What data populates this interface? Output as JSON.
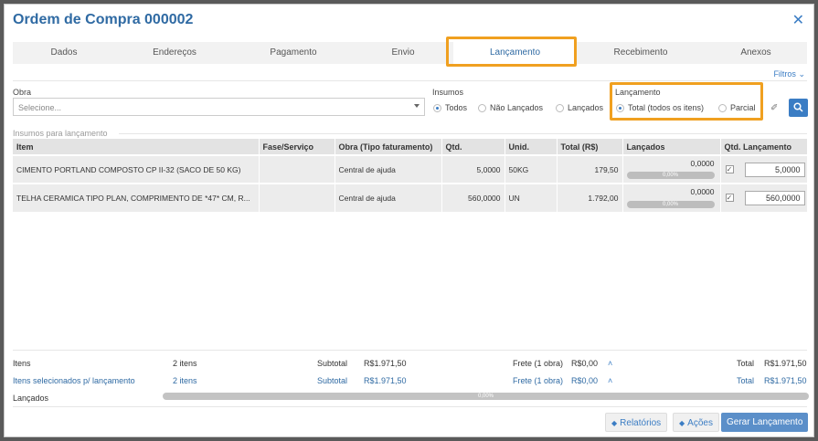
{
  "modal": {
    "title": "Ordem de Compra 000002"
  },
  "tabs": [
    "Dados",
    "Endereços",
    "Pagamento",
    "Envio",
    "Lançamento",
    "Recebimento",
    "Anexos"
  ],
  "active_tab": "Lançamento",
  "filters": {
    "filtros_label": "Filtros",
    "obra_label": "Obra",
    "obra_placeholder": "Selecione...",
    "insumos_label": "Insumos",
    "insumos_options": [
      "Todos",
      "Não Lançados",
      "Lançados"
    ],
    "insumos_selected": "Todos",
    "lancamento_label": "Lançamento",
    "lancamento_options": [
      "Total (todos os itens)",
      "Parcial"
    ],
    "lancamento_selected": "Total (todos os itens)"
  },
  "table": {
    "group_label": "Insumos para lançamento",
    "headers": [
      "Item",
      "Fase/Serviço",
      "Obra (Tipo faturamento)",
      "Qtd.",
      "Unid.",
      "Total (R$)",
      "Lançados",
      "Qtd. Lançamento"
    ],
    "rows": [
      {
        "item": "CIMENTO PORTLAND COMPOSTO CP II-32 (SACO DE 50 KG)",
        "fase": "",
        "obra": "Central de ajuda",
        "qtd": "5,0000",
        "unid": "50KG",
        "total": "179,50",
        "lancados": "0,0000",
        "progress": "0,00%",
        "qtd_lanc": "5,0000"
      },
      {
        "item": "TELHA CERAMICA TIPO PLAN, COMPRIMENTO DE *47* CM, R...",
        "fase": "",
        "obra": "Central de ajuda",
        "qtd": "560,0000",
        "unid": "UN",
        "total": "1.792,00",
        "lancados": "0,0000",
        "progress": "0,00%",
        "qtd_lanc": "560,0000"
      }
    ]
  },
  "footer": {
    "itens_label": "Itens",
    "itens_count": "2 itens",
    "subtotal_label": "Subtotal",
    "subtotal": "R$1.971,50",
    "frete_label": "Frete (1 obra)",
    "frete": "R$0,00",
    "total_label": "Total",
    "total": "R$1.971,50",
    "sel_label": "Itens selecionados p/ lançamento",
    "sel_count": "2 itens",
    "sel_subtotal_label": "Subtotal",
    "sel_subtotal": "R$1.971,50",
    "sel_frete_label": "Frete (1 obra)",
    "sel_frete": "R$0,00",
    "sel_total_label": "Total",
    "sel_total": "R$1.971,50",
    "lancados_label": "Lançados",
    "lancados_progress": "0,00%"
  },
  "buttons": {
    "relatorios": "Relatórios",
    "acoes": "Ações",
    "gerar": "Gerar Lançamento"
  }
}
